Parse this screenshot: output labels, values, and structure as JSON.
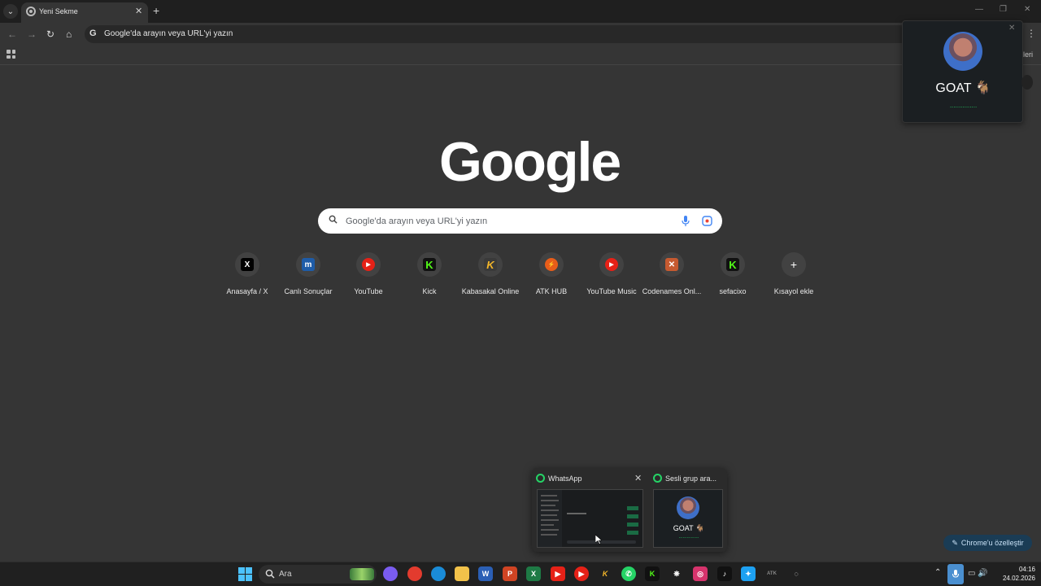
{
  "browser": {
    "tab_title": "Yeni Sekme",
    "omnibox_text": "Google'da arayın veya URL'yi yazın",
    "other_bookmarks_suffix": "leri"
  },
  "ntp": {
    "logo": "Google",
    "search_placeholder": "Google'da arayın veya URL'yi yazın",
    "shortcuts": [
      {
        "label": "Anasayfa / X",
        "icon": "x-icon",
        "color": "#000000",
        "glyph": "X"
      },
      {
        "label": "Canlı Sonuçlar",
        "icon": "mackolik-icon",
        "color": "#1e5ca8",
        "glyph": "m"
      },
      {
        "label": "YouTube",
        "icon": "youtube-icon",
        "color": "#e62117",
        "glyph": "▶"
      },
      {
        "label": "Kick",
        "icon": "kick-icon",
        "color": "#111111",
        "glyph": "K"
      },
      {
        "label": "Kabasakal Online",
        "icon": "kabasakal-icon",
        "color": "#3a3a3a",
        "glyph": "K"
      },
      {
        "label": "ATK HUB",
        "icon": "atk-hub-icon",
        "color": "#e85d1a",
        "glyph": "⚡"
      },
      {
        "label": "YouTube Music",
        "icon": "youtube-music-icon",
        "color": "#e62117",
        "glyph": "▶"
      },
      {
        "label": "Codenames Onl...",
        "icon": "codenames-icon",
        "color": "#c65a30",
        "glyph": "✕"
      },
      {
        "label": "sefacixo",
        "icon": "kick-icon",
        "color": "#111111",
        "glyph": "K"
      },
      {
        "label": "Kısayol ekle",
        "icon": "plus-icon",
        "color": "#424242",
        "glyph": "+"
      }
    ],
    "customize_label": "Chrome'u özelleştir"
  },
  "call_popup": {
    "name": "GOAT 🐐",
    "dots": "..............."
  },
  "taskbar_preview": {
    "item1_title": "WhatsApp",
    "item2_title": "Sesli grup ara...",
    "item2_name": "GOAT 🐐",
    "item2_dots": "..............."
  },
  "taskbar": {
    "search_text": "Ara",
    "time": "04:16",
    "date": "24.02.2026",
    "apps": [
      {
        "icon": "copilot-icon",
        "color": "#7a5cf0",
        "glyph": ""
      },
      {
        "icon": "chrome-icon",
        "color": "#e33b2e",
        "glyph": ""
      },
      {
        "icon": "edge-icon",
        "color": "#1a8cd8",
        "glyph": ""
      },
      {
        "icon": "file-explorer-icon",
        "color": "#f2c24a",
        "glyph": ""
      },
      {
        "icon": "word-icon",
        "color": "#2b5fb5",
        "glyph": "W"
      },
      {
        "icon": "powerpoint-icon",
        "color": "#d04423",
        "glyph": "P"
      },
      {
        "icon": "excel-icon",
        "color": "#1e7a45",
        "glyph": "X"
      },
      {
        "icon": "youtube-icon",
        "color": "#e62117",
        "glyph": "▶"
      },
      {
        "icon": "youtube-music-icon",
        "color": "#e62117",
        "glyph": "▶"
      },
      {
        "icon": "kabasakal-icon",
        "color": "#202020",
        "glyph": "K"
      },
      {
        "icon": "whatsapp-icon",
        "color": "#25d366",
        "glyph": "✆"
      },
      {
        "icon": "kick-icon",
        "color": "#111111",
        "glyph": "K"
      },
      {
        "icon": "chatgpt-icon",
        "color": "#202020",
        "glyph": "❋"
      },
      {
        "icon": "instagram-icon",
        "color": "#d6336c",
        "glyph": "◎"
      },
      {
        "icon": "tiktok-icon",
        "color": "#111111",
        "glyph": "♪"
      },
      {
        "icon": "twitter-icon",
        "color": "#1da1f2",
        "glyph": "✦"
      },
      {
        "icon": "atk-icon",
        "color": "#202020",
        "glyph": "ATK"
      },
      {
        "icon": "discord-activity-icon",
        "color": "#202020",
        "glyph": "◌"
      }
    ]
  }
}
